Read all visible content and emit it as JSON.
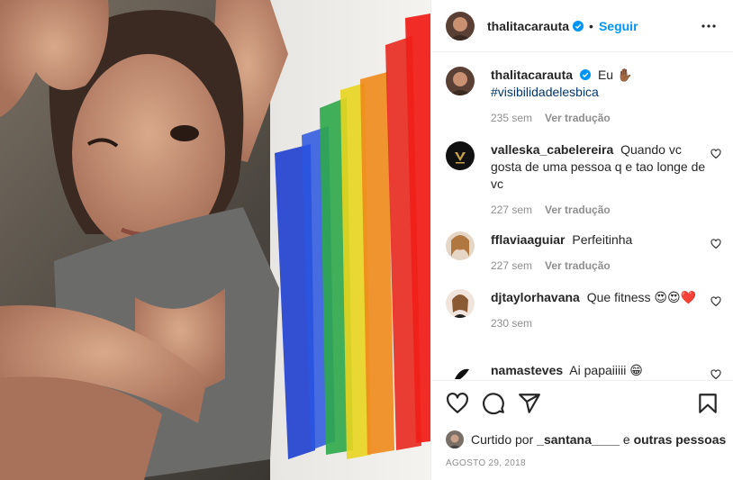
{
  "post": {
    "author": "thalitacarauta",
    "follow_label": "Seguir",
    "separator": "•",
    "caption": {
      "text": "Eu ✋🏾",
      "hashtag": "#visibilidadelesbica",
      "age": "235 sem",
      "translate_label": "Ver tradução"
    }
  },
  "comments": [
    {
      "user": "valleska_cabelereira",
      "text": "Quando vc gosta de uma pessoa q e tao longe de vc",
      "age": "227 sem",
      "translate_label": "Ver tradução"
    },
    {
      "user": "fflaviaaguiar",
      "text": "Perfeitinha",
      "age": "227 sem",
      "translate_label": "Ver tradução"
    },
    {
      "user": "djtaylorhavana",
      "text": "Que fitness 😍😍❤️",
      "age": "230 sem"
    },
    {
      "user": "namasteves",
      "text": "Ai papaiiiii 😁"
    }
  ],
  "likes": {
    "prefix": "Curtido por",
    "user": "_santana____",
    "conjunction": "e",
    "others": "outras pessoas"
  },
  "date": "AGOSTO 29, 2018",
  "colors": {
    "accent": "#0095f6",
    "text": "#262626",
    "muted": "#8e8e8e",
    "hashtag": "#00376b",
    "border": "#efefef"
  },
  "icons": {
    "verified": "verified-badge-icon",
    "more": "more-options-icon",
    "heart": "heart-icon",
    "comment": "comment-icon",
    "share": "share-icon",
    "save": "bookmark-icon"
  }
}
